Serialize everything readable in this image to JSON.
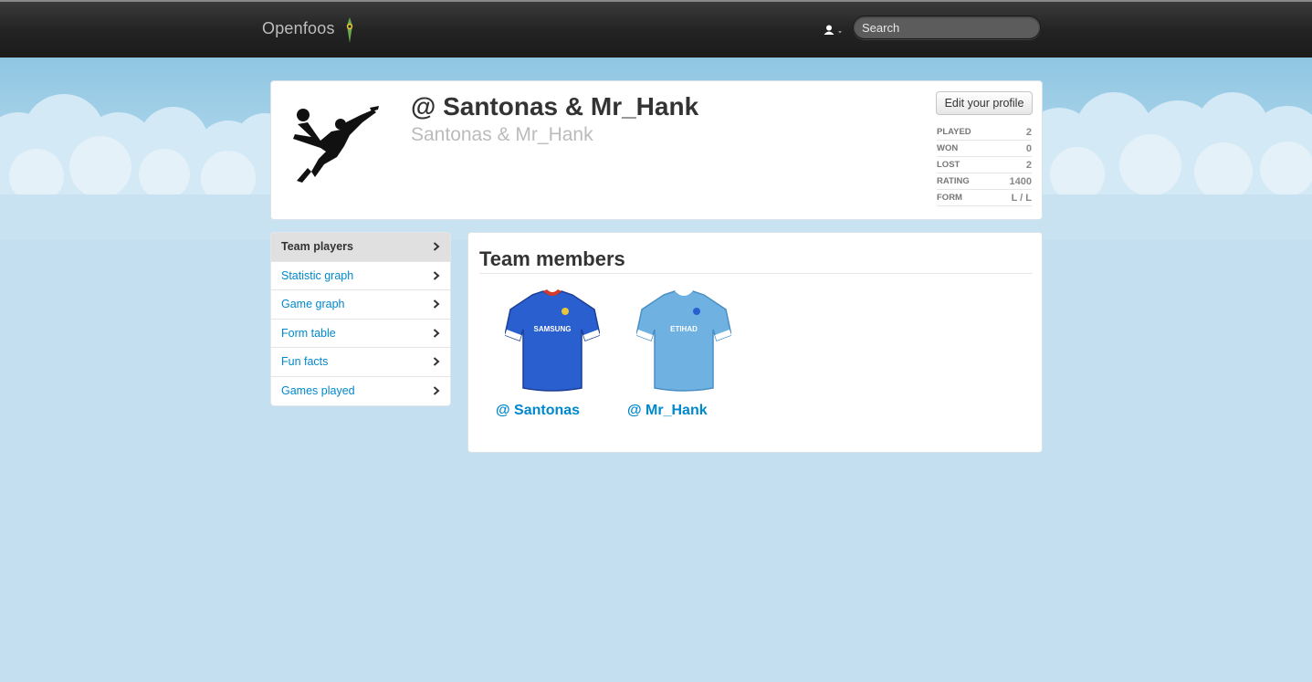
{
  "navbar": {
    "brand": "Openfoos",
    "brand_icon": "openfoos-logo-icon",
    "user_icon": "user-icon",
    "search_placeholder": "Search"
  },
  "profile": {
    "title": "@ Santonas & Mr_Hank",
    "subtitle": "Santonas & Mr_Hank",
    "edit_button": "Edit your profile",
    "stats": [
      {
        "label": "PLAYED",
        "value": "2"
      },
      {
        "label": "WON",
        "value": "0"
      },
      {
        "label": "LOST",
        "value": "2"
      },
      {
        "label": "RATING",
        "value": "1400"
      },
      {
        "label": "FORM",
        "value": "L / L"
      }
    ]
  },
  "sidebar": {
    "items": [
      {
        "label": "Team players",
        "active": true
      },
      {
        "label": "Statistic graph"
      },
      {
        "label": "Game graph"
      },
      {
        "label": "Form table"
      },
      {
        "label": "Fun facts"
      },
      {
        "label": "Games played"
      }
    ]
  },
  "members": {
    "title": "Team members",
    "list": [
      {
        "name": "@ Santonas",
        "shirt_color": "#2a5fd0",
        "collar_color": "#d23a2a",
        "shirt_text": "SAMSUNG"
      },
      {
        "name": "@ Mr_Hank",
        "shirt_color": "#6fb2e2",
        "collar_color": "#ffffff",
        "shirt_text": "ETIHAD"
      }
    ]
  },
  "colors": {
    "link": "#0088cc",
    "sky": "#c3dff0",
    "navbar": "#222222"
  }
}
